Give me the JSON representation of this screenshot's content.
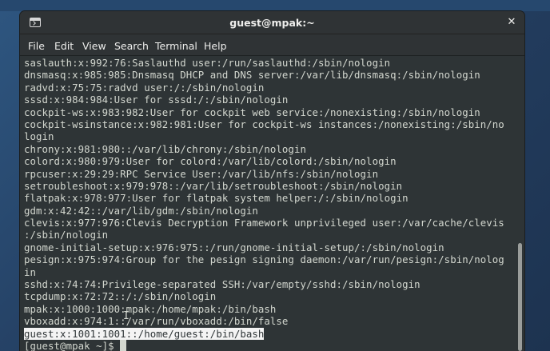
{
  "window": {
    "title": "guest@mpak:~",
    "close_glyph": "✕",
    "icon": "terminal-icon"
  },
  "menu": {
    "items": [
      {
        "label": "File"
      },
      {
        "label": "Edit"
      },
      {
        "label": "View"
      },
      {
        "label": "Search"
      },
      {
        "label": "Terminal"
      },
      {
        "label": "Help"
      }
    ]
  },
  "terminal": {
    "lines": [
      "saslauth:x:992:76:Saslauthd user:/run/saslauthd:/sbin/nologin",
      "dnsmasq:x:985:985:Dnsmasq DHCP and DNS server:/var/lib/dnsmasq:/sbin/nologin",
      "radvd:x:75:75:radvd user:/:/sbin/nologin",
      "sssd:x:984:984:User for sssd:/:/sbin/nologin",
      "cockpit-ws:x:983:982:User for cockpit web service:/nonexisting:/sbin/nologin",
      "cockpit-wsinstance:x:982:981:User for cockpit-ws instances:/nonexisting:/sbin/no",
      "login",
      "chrony:x:981:980::/var/lib/chrony:/sbin/nologin",
      "colord:x:980:979:User for colord:/var/lib/colord:/sbin/nologin",
      "rpcuser:x:29:29:RPC Service User:/var/lib/nfs:/sbin/nologin",
      "setroubleshoot:x:979:978::/var/lib/setroubleshoot:/sbin/nologin",
      "flatpak:x:978:977:User for flatpak system helper:/:/sbin/nologin",
      "gdm:x:42:42::/var/lib/gdm:/sbin/nologin",
      "clevis:x:977:976:Clevis Decryption Framework unprivileged user:/var/cache/clevis",
      ":/sbin/nologin",
      "gnome-initial-setup:x:976:975::/run/gnome-initial-setup/:/sbin/nologin",
      "pesign:x:975:974:Group for the pesign signing daemon:/var/run/pesign:/sbin/nolog",
      "in",
      "sshd:x:74:74:Privilege-separated SSH:/var/empty/sshd:/sbin/nologin",
      "tcpdump:x:72:72::/:/sbin/nologin",
      "mpak:x:1000:1000:mpak:/home/mpak:/bin/bash",
      "vboxadd:x:974:1::/var/run/vboxadd:/bin/false"
    ],
    "selected_line": "guest:x:1001:1001::/home/guest:/bin/bash",
    "prompt": "[guest@mpak ~]$ ",
    "fg_color": "#d3d7cf",
    "bg_color": "#2e3436"
  }
}
